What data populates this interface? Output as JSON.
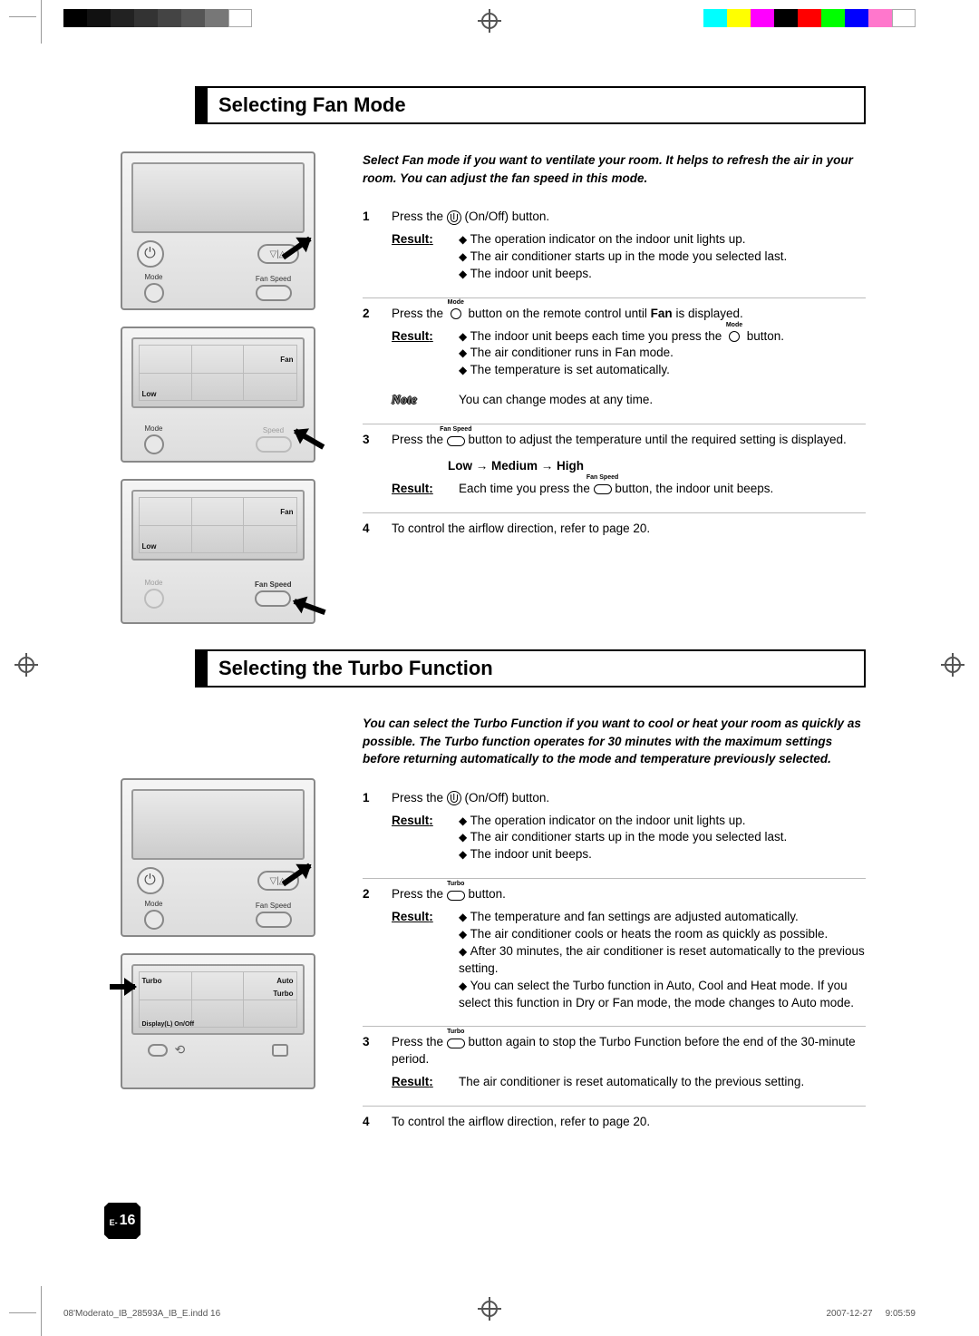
{
  "section_fan": {
    "title": "Selecting Fan Mode",
    "intro": "Select Fan mode if you want to ventilate your room. It helps to refresh the air in your room. You can adjust the fan speed in this mode.",
    "steps": {
      "s1": {
        "num": "1",
        "text_a": "Press the ",
        "text_b": " (On/Off) button.",
        "result_items": [
          "The operation indicator on the indoor unit lights up.",
          "The air conditioner starts up in the mode you selected last.",
          "The indoor unit beeps."
        ]
      },
      "s2": {
        "num": "2",
        "text_a": "Press the ",
        "text_b": " button on the remote control until ",
        "text_c": "Fan",
        "text_d": " is displayed.",
        "result_items": [
          "The indoor unit beeps each time you press the ",
          " button.",
          "The air conditioner runs in Fan mode.",
          "The temperature is set automatically."
        ],
        "note_label": "Note",
        "note_text": "You can change modes at any time."
      },
      "s3": {
        "num": "3",
        "text_a": "Press the ",
        "text_b": " button to adjust the temperature until the required setting is displayed.",
        "sequence": "Low → Medium → High",
        "result_text_a": "Each time you press the ",
        "result_text_b": " button, the indoor unit beeps."
      },
      "s4": {
        "num": "4",
        "text": "To control the airflow direction, refer to page 20."
      }
    },
    "remote_labels": {
      "mode": "Mode",
      "fan_speed": "Fan Speed",
      "low": "Low",
      "fan": "Fan"
    },
    "inline": {
      "mode_label": "Mode",
      "fanspeed_label": "Fan Speed"
    },
    "result_label": "Result"
  },
  "section_turbo": {
    "title": "Selecting the Turbo Function",
    "intro": "You can select the Turbo Function if you want to cool or heat your room as quickly as possible. The Turbo function operates for 30 minutes with the maximum settings before returning automatically to the mode and temperature previously selected.",
    "steps": {
      "s1": {
        "num": "1",
        "text_a": "Press the ",
        "text_b": " (On/Off) button.",
        "result_items": [
          "The operation indicator on the indoor unit lights up.",
          "The air conditioner starts up in the mode you selected last.",
          "The indoor unit beeps."
        ]
      },
      "s2": {
        "num": "2",
        "text_a": "Press the ",
        "text_b": " button.",
        "result_items": [
          "The temperature and fan settings are adjusted automatically.",
          "The air conditioner cools or heats the room as quickly as possible.",
          "After 30 minutes, the air conditioner is reset automatically to the previous setting.",
          "You can select the Turbo function in Auto, Cool and Heat mode. If you select this function in Dry or Fan mode, the mode changes to Auto mode."
        ]
      },
      "s3": {
        "num": "3",
        "text_a": "Press the ",
        "text_b": " button again to stop the Turbo Function before the end of the 30-minute period.",
        "result_text": "The air conditioner is reset automatically to the previous setting."
      },
      "s4": {
        "num": "4",
        "text": "To control the airflow direction, refer to page 20."
      }
    },
    "remote_labels": {
      "mode": "Mode",
      "fan_speed": "Fan Speed",
      "turbo": "Turbo",
      "auto": "Auto",
      "dov": "Display(L) On/Off"
    },
    "inline": {
      "turbo_label": "Turbo"
    },
    "result_label": "Result"
  },
  "page_number_prefix": "E-",
  "page_number": "16",
  "footer": {
    "file": "08'Moderato_IB_28593A_IB_E.indd   16",
    "date": "2007-12-27",
    "time": "9:05:59"
  }
}
